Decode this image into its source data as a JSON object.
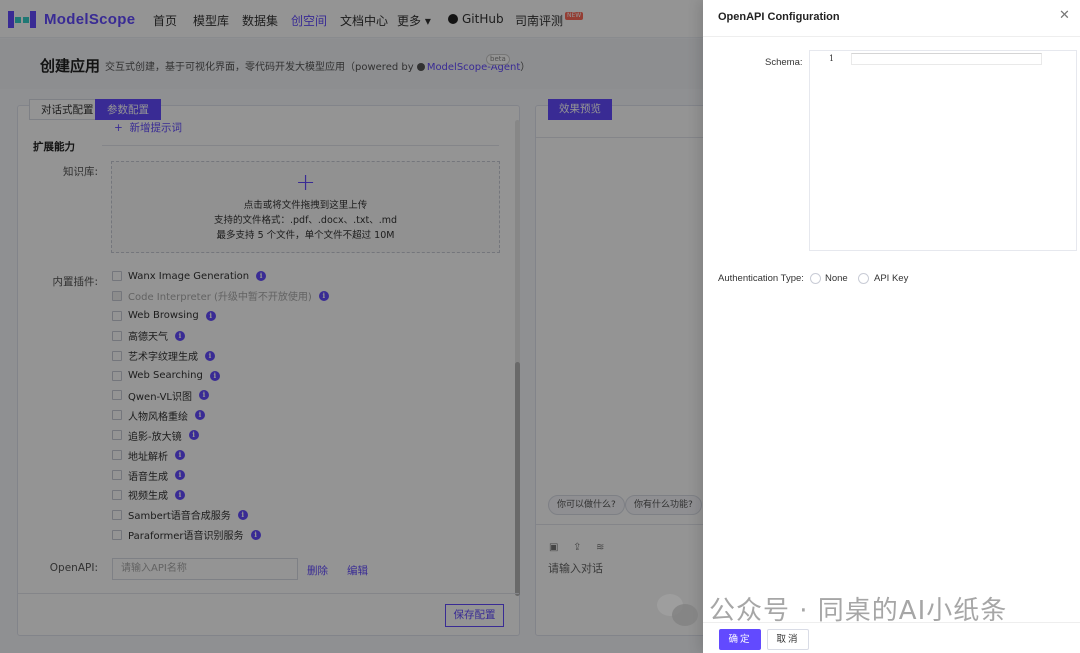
{
  "nav": {
    "logo": "ModelScope",
    "items": [
      "首页",
      "模型库",
      "数据集",
      "创空间",
      "文档中心"
    ],
    "more": "更多 ▾",
    "github": "GitHub",
    "sinan": "司南评测",
    "new_badge": "NEW"
  },
  "header": {
    "title": "创建应用",
    "subtitle_prefix": "交互式创建，基于可视化界面，零代码开发大模型应用（powered by ",
    "subtitle_agent": "ModelScope-Agent",
    "subtitle_suffix": "）",
    "beta": "beta"
  },
  "config": {
    "tabs": [
      "对话式配置",
      "参数配置"
    ],
    "add_prompt": "新增提示词",
    "section_title": "扩展能力",
    "knowledge_label": "知识库:",
    "upload": {
      "plus": "+",
      "line1": "点击或将文件拖拽到这里上传",
      "line2": "支持的文件格式：.pdf、.docx、.txt、.md",
      "line3": "最多支持 5 个文件，单个文件不超过 10M"
    },
    "plugins_label": "内置插件:",
    "plugins": [
      {
        "label": "Wanx Image Generation",
        "disabled": false
      },
      {
        "label": "Code Interpreter (升级中暂不开放使用)",
        "disabled": true
      },
      {
        "label": "Web Browsing",
        "disabled": false
      },
      {
        "label": "高德天气",
        "disabled": false
      },
      {
        "label": "艺术字纹理生成",
        "disabled": false
      },
      {
        "label": "Web Searching",
        "disabled": false
      },
      {
        "label": "Qwen-VL识图",
        "disabled": false
      },
      {
        "label": "人物风格重绘",
        "disabled": false
      },
      {
        "label": "追影-放大镜",
        "disabled": false
      },
      {
        "label": "地址解析",
        "disabled": false
      },
      {
        "label": "语音生成",
        "disabled": false
      },
      {
        "label": "视频生成",
        "disabled": false
      },
      {
        "label": "Sambert语音合成服务",
        "disabled": false
      },
      {
        "label": "Paraformer语音识别服务",
        "disabled": false
      }
    ],
    "info_glyph": "i",
    "openapi_label": "OpenAPI:",
    "openapi_placeholder": "请输入API名称",
    "delete": "删除",
    "edit": "编辑",
    "save": "保存配置"
  },
  "preview": {
    "tab": "效果预览",
    "suggestions": [
      "你可以做什么?",
      "你有什么功能?"
    ],
    "input_placeholder": "请输入对话"
  },
  "drawer": {
    "title": "OpenAPI Configuration",
    "schema_label": "Schema:",
    "line_number": "1",
    "auth_label": "Authentication Type:",
    "auth_options": [
      "None",
      "API Key"
    ],
    "ok": "确定",
    "cancel": "取消",
    "close": "✕"
  },
  "watermark": "公众号 · 同桌的AI小纸条",
  "colors": {
    "accent": "#624aff"
  }
}
